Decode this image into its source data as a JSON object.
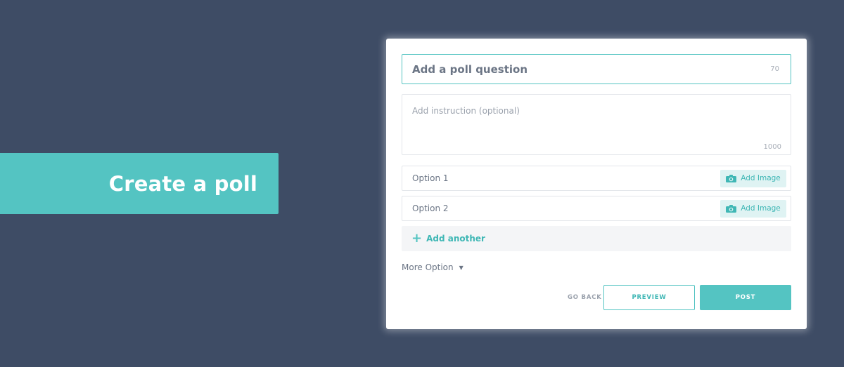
{
  "banner": {
    "title": "Create a poll"
  },
  "form": {
    "question": {
      "placeholder": "Add a poll question",
      "char_limit": "70"
    },
    "instruction": {
      "placeholder": "Add instruction (optional)",
      "char_limit": "1000"
    },
    "options": [
      {
        "label": "Option 1",
        "add_image_label": "Add Image",
        "icon": "camera-icon"
      },
      {
        "label": "Option 2",
        "add_image_label": "Add Image",
        "icon": "camera-icon"
      }
    ],
    "add_another_label": "Add another",
    "more_option_label": "More Option",
    "actions": {
      "go_back": "GO BACK",
      "preview": "PREVIEW",
      "post": "POST"
    }
  },
  "colors": {
    "background": "#3e4c65",
    "accent": "#54c4c2",
    "card": "#ffffff"
  }
}
